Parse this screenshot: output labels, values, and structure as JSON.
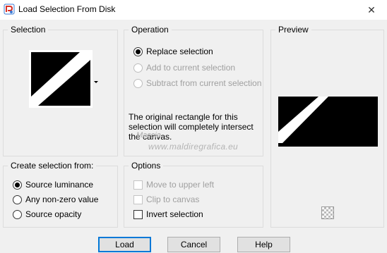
{
  "window": {
    "title": "Load Selection From Disk",
    "close_glyph": "✕"
  },
  "selection_group": {
    "title": "Selection"
  },
  "operation_group": {
    "title": "Operation",
    "options": [
      {
        "label": "Replace selection",
        "checked": true,
        "disabled": false
      },
      {
        "label": "Add to current selection",
        "checked": false,
        "disabled": true
      },
      {
        "label": "Subtract from current selection",
        "checked": false,
        "disabled": true
      }
    ],
    "info_text": "The original rectangle for this selection will completely intersect the canvas."
  },
  "preview_group": {
    "title": "Preview"
  },
  "watermark": {
    "line1": "Maccia",
    "line2": "www.maldiregrafica.eu"
  },
  "create_group": {
    "title": "Create selection from:",
    "options": [
      {
        "label": "Source luminance",
        "checked": true
      },
      {
        "label": "Any non-zero value",
        "checked": false
      },
      {
        "label": "Source opacity",
        "checked": false
      }
    ]
  },
  "options_group": {
    "title": "Options",
    "items": [
      {
        "label": "Move to upper left",
        "checked": false,
        "disabled": true
      },
      {
        "label": "Clip to canvas",
        "checked": false,
        "disabled": true
      },
      {
        "label": "Invert selection",
        "checked": false,
        "disabled": false
      }
    ]
  },
  "buttons": {
    "load": "Load",
    "cancel": "Cancel",
    "help": "Help"
  },
  "colors": {
    "accent": "#0078d7",
    "background": "#f0f0f0",
    "disabled_text": "#a0a0a0"
  }
}
